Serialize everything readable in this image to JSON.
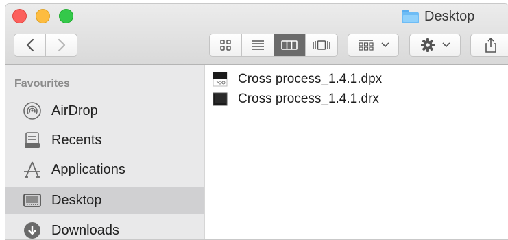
{
  "window": {
    "title": "Desktop",
    "title_icon": "folder-icon"
  },
  "toolbar": {
    "back_icon": "chevron-left-icon",
    "forward_icon": "chevron-right-icon",
    "view_modes": [
      {
        "icon": "icon-view-icon",
        "active": false
      },
      {
        "icon": "list-view-icon",
        "active": false
      },
      {
        "icon": "column-view-icon",
        "active": true
      },
      {
        "icon": "cover-flow-icon",
        "active": false
      }
    ],
    "arrange_icon": "group-grid-icon",
    "action_icon": "gear-icon",
    "share_icon": "share-icon"
  },
  "sidebar": {
    "section_title": "Favourites",
    "items": [
      {
        "label": "AirDrop",
        "icon": "airdrop-icon",
        "selected": false
      },
      {
        "label": "Recents",
        "icon": "recents-icon",
        "selected": false
      },
      {
        "label": "Applications",
        "icon": "applications-icon",
        "selected": false
      },
      {
        "label": "Desktop",
        "icon": "desktop-icon",
        "selected": true
      },
      {
        "label": "Downloads",
        "icon": "downloads-icon",
        "selected": false
      }
    ]
  },
  "files": [
    {
      "name": "Cross process_1.4.1.dpx",
      "icon": "dpx-file-icon"
    },
    {
      "name": "Cross process_1.4.1.drx",
      "icon": "drx-file-icon"
    }
  ],
  "colors": {
    "toolbar_bg": "#dedede",
    "sidebar_bg": "#e9e9ea",
    "selected_bg": "#d0d0d2",
    "folder_blue": "#6ebcf5",
    "active_view": "#6b6b6b"
  }
}
